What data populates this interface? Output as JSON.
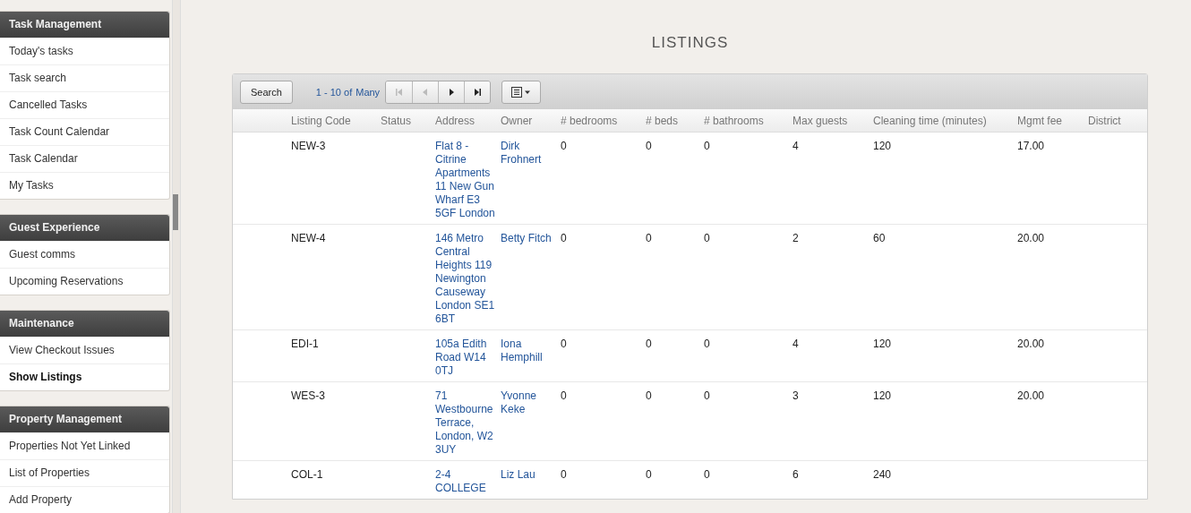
{
  "sidebar": {
    "groups": [
      {
        "title": "Task Management",
        "items": [
          {
            "label": "Today's tasks",
            "selected": false
          },
          {
            "label": "Task search",
            "selected": false
          },
          {
            "label": "Cancelled Tasks",
            "selected": false
          },
          {
            "label": "Task Count Calendar",
            "selected": false
          },
          {
            "label": "Task Calendar",
            "selected": false
          },
          {
            "label": "My Tasks",
            "selected": false
          }
        ]
      },
      {
        "title": "Guest Experience",
        "items": [
          {
            "label": "Guest comms",
            "selected": false
          },
          {
            "label": "Upcoming Reservations",
            "selected": false
          }
        ]
      },
      {
        "title": "Maintenance",
        "items": [
          {
            "label": "View Checkout Issues",
            "selected": false
          },
          {
            "label": "Show Listings",
            "selected": true
          }
        ]
      },
      {
        "title": "Property Management",
        "items": [
          {
            "label": "Properties Not Yet Linked",
            "selected": false
          },
          {
            "label": "List of Properties",
            "selected": false
          },
          {
            "label": "Add Property",
            "selected": false
          }
        ]
      }
    ]
  },
  "page_title": "LISTINGS",
  "toolbar": {
    "search_button": "Search",
    "range": "1 - 10 of",
    "total": "Many",
    "pager": [
      {
        "kind": "first",
        "disabled": true
      },
      {
        "kind": "prev",
        "disabled": true
      },
      {
        "kind": "next",
        "disabled": false
      },
      {
        "kind": "last",
        "disabled": false
      }
    ]
  },
  "table": {
    "columns": [
      "Listing Code",
      "Status",
      "Address",
      "Owner",
      "# bedrooms",
      "# beds",
      "# bathrooms",
      "Max guests",
      "Cleaning time (minutes)",
      "Mgmt fee",
      "District"
    ],
    "rows": [
      {
        "code": "NEW-3",
        "address": "Flat 8 - Citrine Apartments 11 New Gun Wharf E3 5GF London",
        "owner": "Dirk Frohnert",
        "bedrooms": "0",
        "beds": "0",
        "bathrooms": "0",
        "max_guests": "4",
        "cleaning": "120",
        "fee": "17.00"
      },
      {
        "code": "NEW-4",
        "address": "146 Metro Central Heights 119 Newington Causeway London SE1 6BT",
        "owner": "Betty Fitch",
        "bedrooms": "0",
        "beds": "0",
        "bathrooms": "0",
        "max_guests": "2",
        "cleaning": "60",
        "fee": "20.00"
      },
      {
        "code": "EDI-1",
        "address": "105a Edith Road W14 0TJ",
        "owner": "Iona Hemphill",
        "bedrooms": "0",
        "beds": "0",
        "bathrooms": "0",
        "max_guests": "4",
        "cleaning": "120",
        "fee": "20.00"
      },
      {
        "code": "WES-3",
        "address": "71 Westbourne Terrace, London, W2 3UY",
        "owner": "Yvonne Keke",
        "bedrooms": "0",
        "beds": "0",
        "bathrooms": "0",
        "max_guests": "3",
        "cleaning": "120",
        "fee": "20.00"
      },
      {
        "code": "COL-1",
        "address": "2-4 COLLEGE",
        "owner": "Liz Lau",
        "bedrooms": "0",
        "beds": "0",
        "bathrooms": "0",
        "max_guests": "6",
        "cleaning": "240",
        "fee": ""
      }
    ]
  }
}
